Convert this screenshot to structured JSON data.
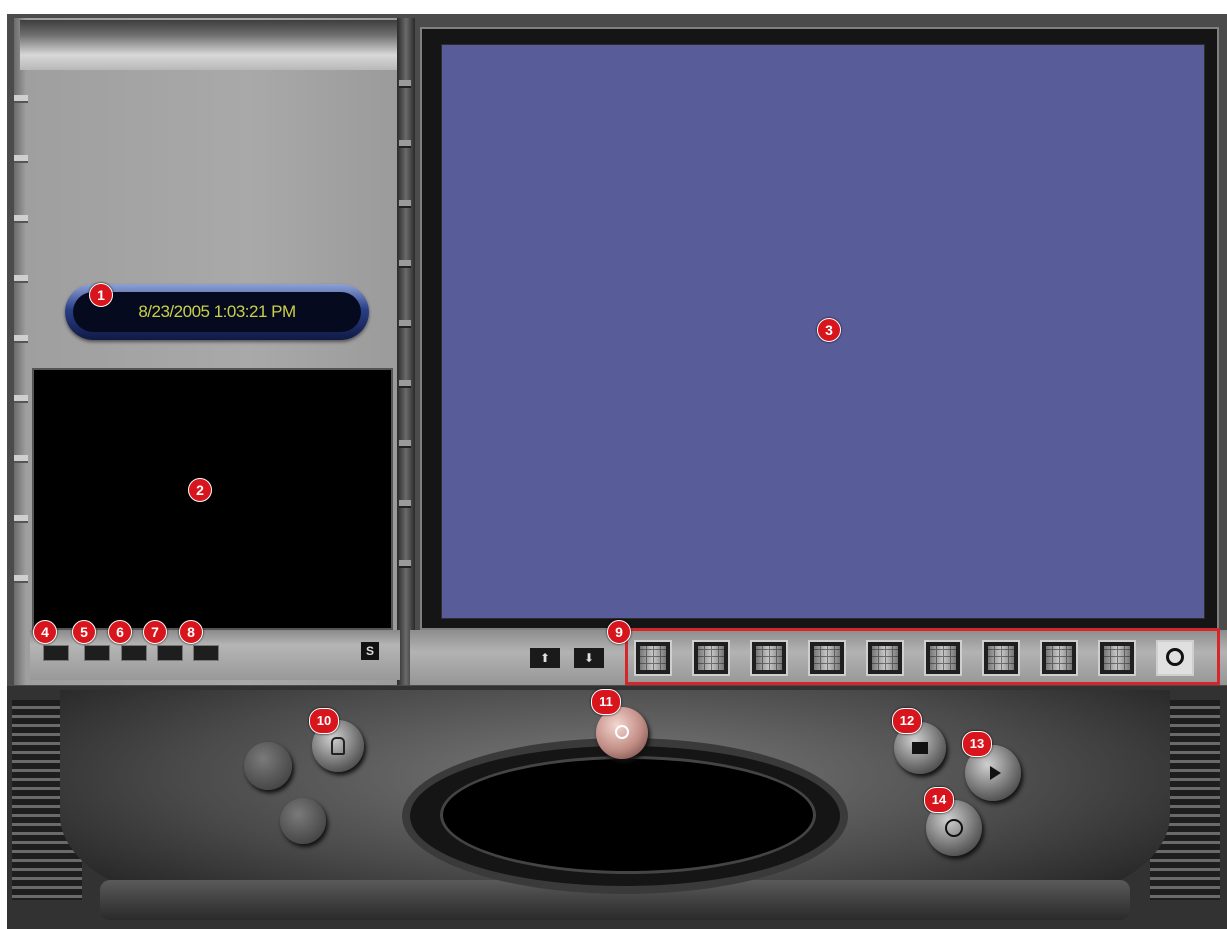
{
  "datetime": {
    "value": "8/23/2005 1:03:21 PM"
  },
  "search_btn_label": "S",
  "page_nav": {
    "up": "⬆",
    "down": "⬇"
  },
  "badges": [
    "1",
    "2",
    "3",
    "4",
    "5",
    "6",
    "7",
    "8",
    "9",
    "10",
    "11",
    "12",
    "13",
    "14"
  ],
  "toolbar_buttons": [
    "tool-4",
    "tool-5",
    "tool-6",
    "tool-7",
    "tool-8"
  ],
  "layout_buttons": [
    "layout-1",
    "layout-2",
    "layout-3",
    "layout-4",
    "layout-5",
    "layout-6",
    "layout-7",
    "layout-8",
    "layout-9",
    "layout-10"
  ],
  "colors": {
    "screen": "#585d9a",
    "badge": "#d8141c",
    "highlight": "#d4262b",
    "clock_text": "#c8d04a"
  }
}
